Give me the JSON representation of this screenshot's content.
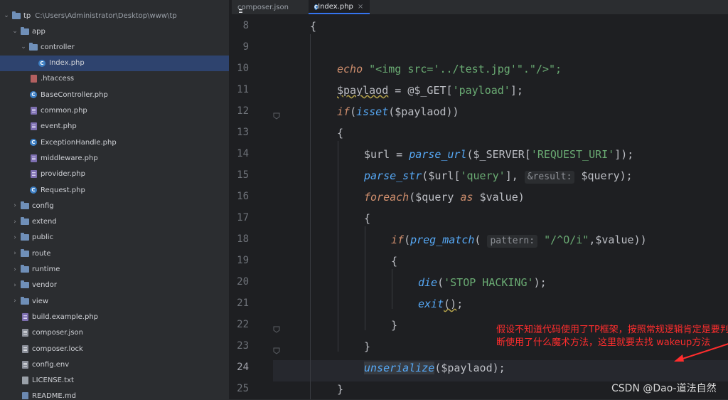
{
  "project_tree": {
    "root": {
      "name": "tp",
      "path": "C:\\Users\\Administrator\\Desktop\\www\\tp"
    },
    "items": [
      {
        "label": "app",
        "type": "folder",
        "depth": 1,
        "open": true
      },
      {
        "label": "controller",
        "type": "folder",
        "depth": 2,
        "open": true
      },
      {
        "label": "Index.php",
        "type": "php-class",
        "depth": 3,
        "selected": true
      },
      {
        "label": ".htaccess",
        "type": "htaccess",
        "depth": 2
      },
      {
        "label": "BaseController.php",
        "type": "php-class",
        "depth": 2
      },
      {
        "label": "common.php",
        "type": "php",
        "depth": 2
      },
      {
        "label": "event.php",
        "type": "php",
        "depth": 2
      },
      {
        "label": "ExceptionHandle.php",
        "type": "php-class",
        "depth": 2
      },
      {
        "label": "middleware.php",
        "type": "php",
        "depth": 2
      },
      {
        "label": "provider.php",
        "type": "php",
        "depth": 2
      },
      {
        "label": "Request.php",
        "type": "php-class",
        "depth": 2
      },
      {
        "label": "config",
        "type": "folder",
        "depth": 1
      },
      {
        "label": "extend",
        "type": "folder",
        "depth": 1
      },
      {
        "label": "public",
        "type": "folder",
        "depth": 1
      },
      {
        "label": "route",
        "type": "folder",
        "depth": 1
      },
      {
        "label": "runtime",
        "type": "folder",
        "depth": 1
      },
      {
        "label": "vendor",
        "type": "folder",
        "depth": 1
      },
      {
        "label": "view",
        "type": "folder",
        "depth": 1
      },
      {
        "label": "build.example.php",
        "type": "php",
        "depth": 1
      },
      {
        "label": "composer.json",
        "type": "json",
        "depth": 1
      },
      {
        "label": "composer.lock",
        "type": "json",
        "depth": 1
      },
      {
        "label": "config.env",
        "type": "json",
        "depth": 1
      },
      {
        "label": "LICENSE.txt",
        "type": "txt",
        "depth": 1
      },
      {
        "label": "README.md",
        "type": "md",
        "depth": 1
      }
    ]
  },
  "tabs": [
    {
      "label": "composer.json",
      "active": false
    },
    {
      "label": "Index.php",
      "active": true
    }
  ],
  "editor": {
    "line_numbers": [
      "8",
      "9",
      "10",
      "11",
      "12",
      "13",
      "14",
      "15",
      "16",
      "17",
      "18",
      "19",
      "20",
      "21",
      "22",
      "23",
      "24",
      "25"
    ],
    "current_line": "24",
    "code": {
      "l8": "{",
      "l10_echo": "echo",
      "l10_str": "\"<img src='../test.jpg'\".\"/>\";",
      "l11_var": "$paylaod",
      "l11_eq": " = @",
      "l11_get": "$_GET",
      "l11_key": "'payload'",
      "l12_if": "if",
      "l12_isset": "isset",
      "l12_var": "$paylaod",
      "l13": "{",
      "l14_var": "$url",
      "l14_eq": " = ",
      "l14_fn": "parse_url",
      "l14_server": "$_SERVER",
      "l14_key": "'REQUEST_URI'",
      "l15_fn": "parse_str",
      "l15_var": "$url",
      "l15_key": "'query'",
      "l15_hint": "&result:",
      "l15_var2": "$query",
      "l16_foreach": "foreach",
      "l16_var": "$query",
      "l16_as": "as",
      "l16_var2": "$value",
      "l17": "{",
      "l18_if": "if",
      "l18_fn": "preg_match",
      "l18_hint": "pattern:",
      "l18_str": "\"/^O/i\"",
      "l18_var": "$value",
      "l19": "{",
      "l20_fn": "die",
      "l20_str": "'STOP HACKING'",
      "l21_fn": "exit",
      "l22": "}",
      "l23": "}",
      "l24_fn": "unserialize",
      "l24_var": "$paylaod",
      "l25": "}"
    }
  },
  "annotation": {
    "text": "假设不知道代码使用了TP框架，按照常规逻辑肯定是要判断使用了什么魔术方法，这里就要去找 wakeup方法",
    "color": "#ff2d2d"
  },
  "watermark": "CSDN @Dao-道法自然"
}
